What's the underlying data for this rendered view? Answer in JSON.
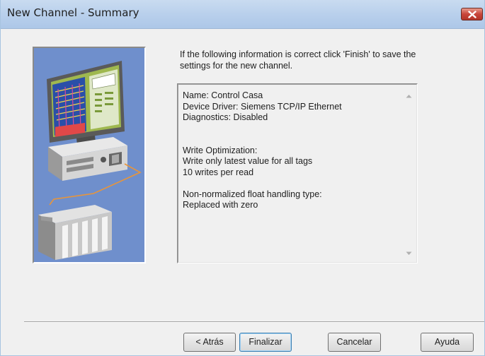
{
  "window": {
    "title": "New Channel - Summary"
  },
  "intro_text": "If the following information is correct click 'Finish' to save the settings for the new channel.",
  "summary_lines": [
    "Name: Control Casa",
    "Device Driver: Siemens TCP/IP Ethernet",
    "Diagnostics: Disabled",
    "",
    "",
    "Write Optimization:",
    "Write only latest value for all tags",
    "10 writes per read",
    "",
    "Non-normalized float handling type:",
    "Replaced with zero"
  ],
  "buttons": {
    "back": "< Atrás",
    "finish": "Finalizar",
    "cancel": "Cancelar",
    "help": "Ayuda"
  },
  "icons": {
    "close": "close-icon",
    "illustration": "computer-and-plc-illustration",
    "scroll_up": "scroll-up-arrow-icon",
    "scroll_down": "scroll-down-arrow-icon"
  }
}
